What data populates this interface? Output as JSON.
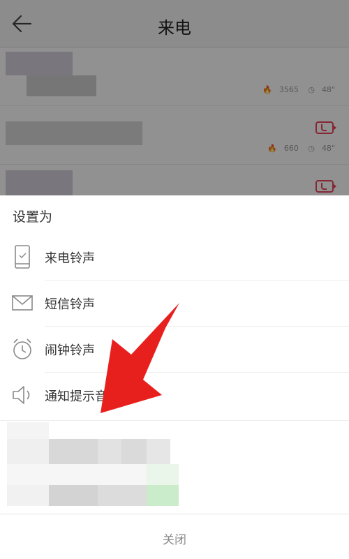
{
  "header": {
    "title": "来电"
  },
  "list": {
    "items": [
      {
        "likes": "3565",
        "duration": "48\""
      },
      {
        "likes": "660",
        "duration": "48\""
      }
    ]
  },
  "sheet": {
    "title": "设置为",
    "options": [
      {
        "label": "来电铃声",
        "icon": "phone-icon"
      },
      {
        "label": "短信铃声",
        "icon": "envelope-icon"
      },
      {
        "label": "闹钟铃声",
        "icon": "alarm-clock-icon"
      },
      {
        "label": "通知提示音",
        "icon": "speaker-icon"
      }
    ],
    "close_label": "关闭"
  },
  "colors": {
    "accent": "#e8475b",
    "arrow": "#e8201d",
    "overlay": "rgba(0,0,0,0.43)"
  }
}
